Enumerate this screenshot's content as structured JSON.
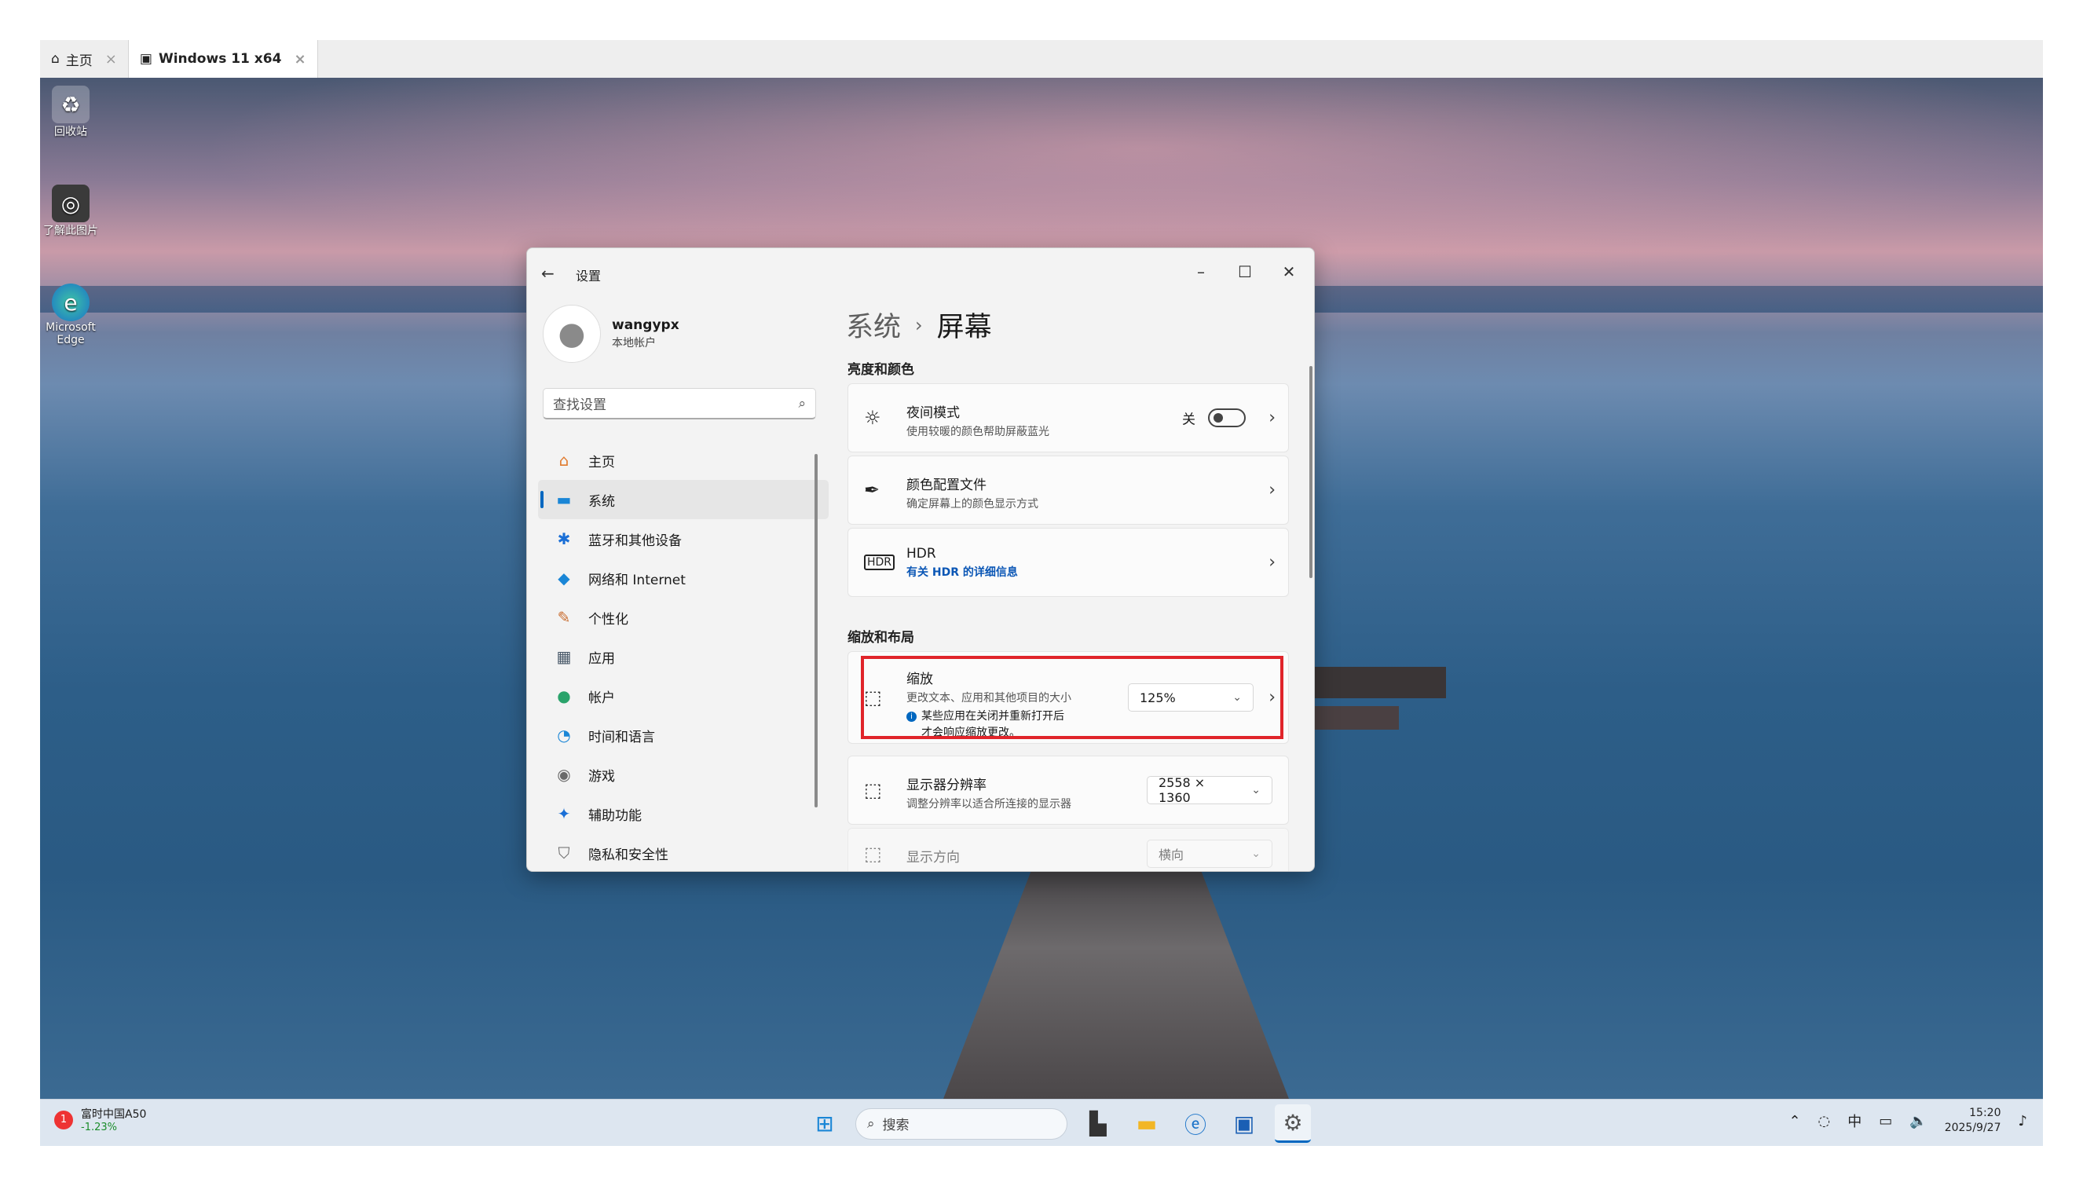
{
  "vm_tabs": [
    {
      "label": "主页",
      "icon": "home-icon"
    },
    {
      "label": "Windows 11 x64",
      "icon": "vm-icon"
    }
  ],
  "desktop_icons": [
    {
      "label": "回收站",
      "icon": "recycle-bin-icon"
    },
    {
      "label": "了解此图片",
      "icon": "camera-icon"
    },
    {
      "label": "Microsoft Edge",
      "icon": "edge-icon"
    }
  ],
  "settings": {
    "title": "设置",
    "user": {
      "name": "wangypx",
      "type": "本地帐户"
    },
    "search_placeholder": "查找设置",
    "nav": [
      {
        "label": "主页",
        "icon": "home-icon"
      },
      {
        "label": "系统",
        "icon": "system-icon",
        "selected": true
      },
      {
        "label": "蓝牙和其他设备",
        "icon": "bluetooth-icon"
      },
      {
        "label": "网络和 Internet",
        "icon": "wifi-icon"
      },
      {
        "label": "个性化",
        "icon": "brush-icon"
      },
      {
        "label": "应用",
        "icon": "apps-icon"
      },
      {
        "label": "帐户",
        "icon": "account-icon"
      },
      {
        "label": "时间和语言",
        "icon": "globe-clock-icon"
      },
      {
        "label": "游戏",
        "icon": "gamepad-icon"
      },
      {
        "label": "辅助功能",
        "icon": "accessibility-icon"
      },
      {
        "label": "隐私和安全性",
        "icon": "shield-icon"
      }
    ],
    "breadcrumb": {
      "parent": "系统",
      "separator": "›",
      "current": "屏幕"
    },
    "sections": {
      "brightness": "亮度和颜色",
      "scale_layout": "缩放和布局"
    },
    "night_light": {
      "title": "夜间模式",
      "desc": "使用较暖的颜色帮助屏蔽蓝光",
      "state": "关"
    },
    "color_profile": {
      "title": "颜色配置文件",
      "desc": "确定屏幕上的颜色显示方式"
    },
    "hdr": {
      "title": "HDR",
      "desc": "有关 HDR 的详细信息"
    },
    "scale": {
      "title": "缩放",
      "desc": "更改文本、应用和其他项目的大小",
      "note_line1": "某些应用在关闭并重新打开后",
      "note_line2": "才会响应缩放更改。",
      "value": "125%"
    },
    "resolution": {
      "title": "显示器分辨率",
      "desc": "调整分辨率以适合所连接的显示器",
      "value": "2558 × 1360"
    },
    "orientation": {
      "title": "显示方向",
      "value": "横向"
    }
  },
  "taskbar": {
    "stock_name": "富时中国A50",
    "stock_change": "-1.23%",
    "stock_badge": "1",
    "search_label": "搜索",
    "ime": "中",
    "time": "15:20",
    "date": "2025/9/27"
  },
  "colors": {
    "accent": "#0067c0",
    "highlight_box": "#e0242a",
    "stock_down": "#1a8c2a"
  }
}
